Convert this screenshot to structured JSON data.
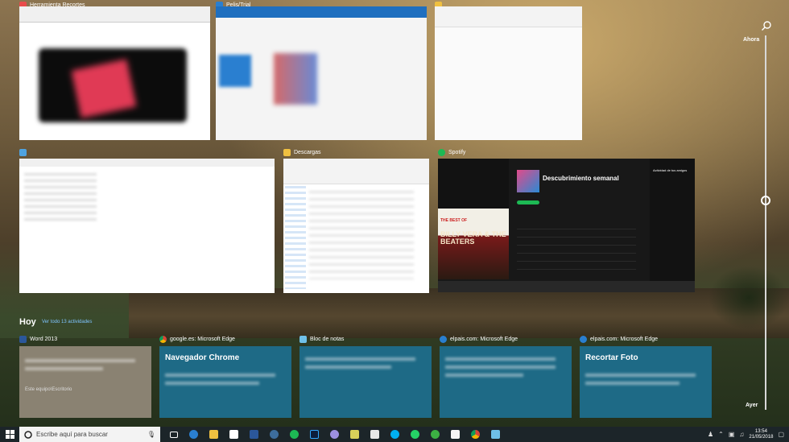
{
  "windows": [
    {
      "title": "Herramienta Recortes",
      "icon_color": "#e84b4b"
    },
    {
      "title": "Pelis/Trial",
      "icon_color": "#2a7fd0"
    },
    {
      "title": "",
      "icon_color": "#f0c040"
    },
    {
      "title": "",
      "icon_color": "#4fa3e0"
    },
    {
      "title": "Descargas",
      "icon_color": "#f0c040"
    },
    {
      "title": "Spotify",
      "icon_color": "#1db954"
    }
  ],
  "spotify": {
    "heading": "Descubrimiento semanal",
    "album_title": "BILLY VERA & THE BEATERS",
    "album_sub": "THE BEST OF",
    "friends_title": "Actividad de tus amigos"
  },
  "timeline": {
    "section_title": "Hoy",
    "see_all": "Ver todo 13 actividades",
    "top_label": "Ahora",
    "bottom_label": "Ayer"
  },
  "activity_cards": [
    {
      "app": "Word 2013",
      "title": "",
      "footer": "Este equipo\\Escritorio",
      "bg": "#8a8272",
      "icon_color": "#2b579a"
    },
    {
      "app": "google.es: Microsoft Edge",
      "title": "Navegador Chrome",
      "footer": "",
      "bg": "#1e6a86",
      "icon_color": "#4fa3e0"
    },
    {
      "app": "Bloc de notas",
      "title": "",
      "footer": "",
      "bg": "#1e6a86",
      "icon_color": "#6fc0e8"
    },
    {
      "app": "elpais.com: Microsoft Edge",
      "title": "",
      "footer": "",
      "bg": "#1e6a86",
      "icon_color": "#2a7fd0"
    },
    {
      "app": "elpais.com: Microsoft Edge",
      "title": "Recortar Foto",
      "footer": "",
      "bg": "#1e6a86",
      "icon_color": "#2a7fd0"
    }
  ],
  "taskbar": {
    "search_placeholder": "Escribe aquí para buscar",
    "time": "13:54",
    "date": "21/05/2018",
    "icons": [
      "task-view-icon",
      "edge-icon",
      "file-explorer-icon",
      "store-icon",
      "word-icon",
      "steam-icon",
      "spotify-icon",
      "photoshop-icon",
      "app-icon",
      "app-icon",
      "app-icon",
      "skype-icon",
      "whatsapp-icon",
      "app-icon",
      "mail-icon",
      "chrome-icon",
      "notepad-icon"
    ]
  }
}
